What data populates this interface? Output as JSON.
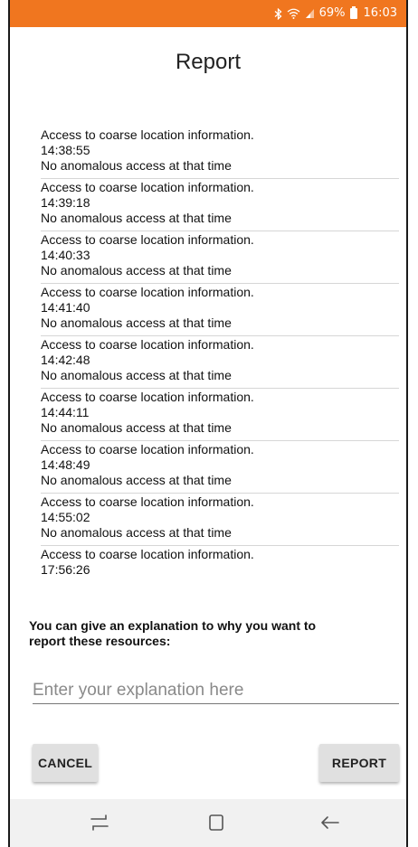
{
  "status_bar": {
    "color": "#f0761f",
    "battery": "69%",
    "time": "16:03"
  },
  "page": {
    "title": "Report"
  },
  "access_list": [
    {
      "line1": "Access to coarse location information.",
      "time": "14:38:55",
      "line3": "No anomalous access at that time"
    },
    {
      "line1": "Access to coarse location information.",
      "time": "14:39:18",
      "line3": "No anomalous access at that time"
    },
    {
      "line1": "Access to coarse location information.",
      "time": "14:40:33",
      "line3": "No anomalous access at that time"
    },
    {
      "line1": "Access to coarse location information.",
      "time": "14:41:40",
      "line3": "No anomalous access at that time"
    },
    {
      "line1": "Access to coarse location information.",
      "time": "14:42:48",
      "line3": "No anomalous access at that time"
    },
    {
      "line1": "Access to coarse location information.",
      "time": "14:44:11",
      "line3": "No anomalous access at that time"
    },
    {
      "line1": "Access to coarse location information.",
      "time": "14:48:49",
      "line3": "No anomalous access at that time"
    },
    {
      "line1": "Access to coarse location information.",
      "time": "14:55:02",
      "line3": "No anomalous access at that time"
    },
    {
      "line1": "Access to coarse location information.",
      "time": "17:56:26"
    }
  ],
  "explanation": {
    "label": "You can give an explanation to why you want to report these resources:",
    "placeholder": "Enter your explanation here",
    "value": ""
  },
  "buttons": {
    "cancel": "CANCEL",
    "report": "REPORT"
  },
  "icons": {
    "bluetooth": "bluetooth-icon",
    "wifi": "wifi-icon",
    "signal": "signal-icon",
    "battery": "battery-icon",
    "nav_recent": "recent-apps-icon",
    "nav_home": "home-icon",
    "nav_back": "back-icon"
  }
}
